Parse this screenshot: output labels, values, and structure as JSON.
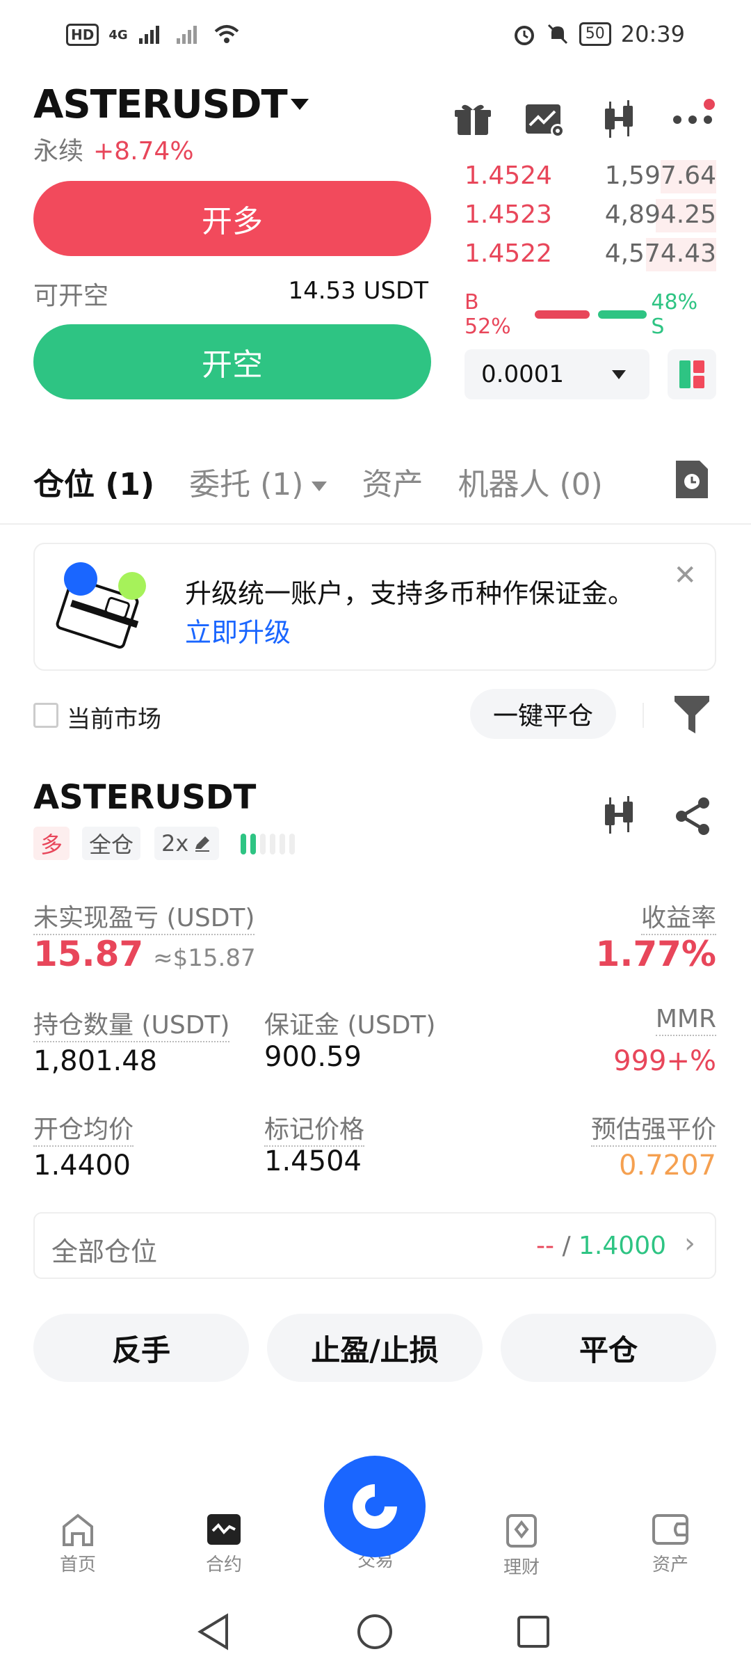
{
  "status_bar": {
    "hd": "HD",
    "network": "4G",
    "battery": "50",
    "time": "20:39"
  },
  "header": {
    "pair": "ASTERUSDT",
    "type": "永续",
    "change": "+8.74%"
  },
  "trade": {
    "long_label": "开多",
    "short_label": "开空",
    "avail_label": "可开空",
    "avail_value": "14.53 USDT"
  },
  "orderbook": {
    "asks": [
      {
        "price": "1.4524",
        "qty": "1,597.64",
        "depth": 0.22
      },
      {
        "price": "1.4523",
        "qty": "4,894.25",
        "depth": 0.24
      },
      {
        "price": "1.4522",
        "qty": "4,574.43",
        "depth": 0.28
      }
    ],
    "buy_ratio": "B 52%",
    "sell_ratio": "48% S",
    "step": "0.0001"
  },
  "tabs": [
    {
      "label": "仓位 (1)"
    },
    {
      "label": "委托 (1)"
    },
    {
      "label": "资产"
    },
    {
      "label": "机器人 (0)"
    }
  ],
  "promo": {
    "text": "升级统一账户，支持多币种作保证金。",
    "link": "立即升级"
  },
  "filter": {
    "current_market": "当前市场",
    "close_all": "一键平仓"
  },
  "position": {
    "symbol": "ASTERUSDT",
    "side_tag": "多",
    "margin_mode": "全仓",
    "leverage": "2x",
    "upnl_label": "未实现盈亏 (USDT)",
    "upnl_value": "15.87",
    "upnl_approx": "≈$15.87",
    "roe_label": "收益率",
    "roe_value": "1.77%",
    "size_label": "持仓数量 (USDT)",
    "size_value": "1,801.48",
    "margin_label": "保证金 (USDT)",
    "margin_value": "900.59",
    "mmr_label": "MMR",
    "mmr_value": "999+%",
    "entry_label": "开仓均价",
    "entry_value": "1.4400",
    "mark_label": "标记价格",
    "mark_value": "1.4504",
    "liq_label": "预估强平价",
    "liq_value": "0.7207",
    "all_label": "全部仓位",
    "all_tp": "--",
    "all_sep": " / ",
    "all_sl": "1.4000"
  },
  "actions": {
    "reverse": "反手",
    "tpsl": "止盈/止损",
    "close": "平仓"
  },
  "nav": {
    "home": "首页",
    "contract": "合约",
    "trade": "交易",
    "finance": "理财",
    "assets": "资产"
  },
  "colors": {
    "red": "#f24a5c",
    "green": "#2ec483",
    "blue": "#1a66ff",
    "orange": "#f5a050"
  }
}
